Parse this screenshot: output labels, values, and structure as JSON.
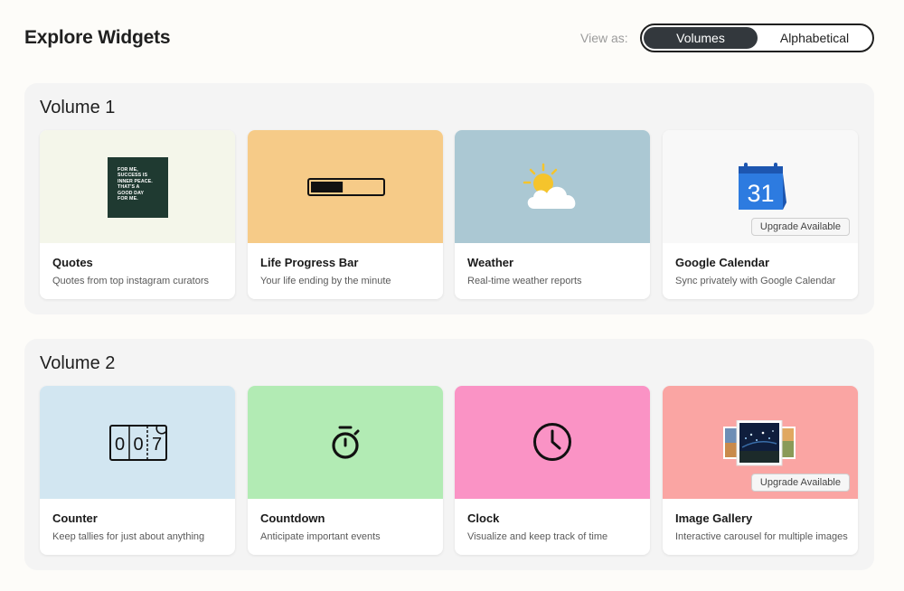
{
  "header": {
    "title": "Explore Widgets",
    "view_as_label": "View as:",
    "toggle": {
      "active": "Volumes",
      "inactive": "Alphabetical"
    }
  },
  "sections": [
    {
      "title": "Volume 1",
      "cards": [
        {
          "title": "Quotes",
          "desc": "Quotes from top instagram curators",
          "bg": "#f4f6ea",
          "icon": "quote-image-icon",
          "quote_lines": [
            "FOR ME,",
            "SUCCESS IS",
            "INNER PEACE.",
            "THAT'S A",
            "GOOD DAY",
            "FOR ME."
          ]
        },
        {
          "title": "Life Progress Bar",
          "desc": "Your life ending by the minute",
          "bg": "#f6cb88",
          "icon": "progress-bar-icon",
          "progress": 0.45
        },
        {
          "title": "Weather",
          "desc": "Real-time weather reports",
          "bg": "#abc8d3",
          "icon": "sun-cloud-icon"
        },
        {
          "title": "Google Calendar",
          "desc": "Sync privately with Google Calendar",
          "bg": "#f8f8f8",
          "icon": "google-calendar-icon",
          "calendar_day": "31",
          "badge": "Upgrade Available"
        }
      ]
    },
    {
      "title": "Volume 2",
      "cards": [
        {
          "title": "Counter",
          "desc": "Keep tallies for just about anything",
          "bg": "#d2e6f1",
          "icon": "counter-icon",
          "counter_digits": [
            "0",
            "0",
            "7"
          ]
        },
        {
          "title": "Countdown",
          "desc": "Anticipate important events",
          "bg": "#b2ebb4",
          "icon": "stopwatch-icon"
        },
        {
          "title": "Clock",
          "desc": "Visualize and keep track of time",
          "bg": "#fa93c5",
          "icon": "clock-icon"
        },
        {
          "title": "Image Gallery",
          "desc": "Interactive carousel for multiple images",
          "bg": "#faa5a3",
          "icon": "image-gallery-icon",
          "badge": "Upgrade Available"
        }
      ]
    }
  ]
}
